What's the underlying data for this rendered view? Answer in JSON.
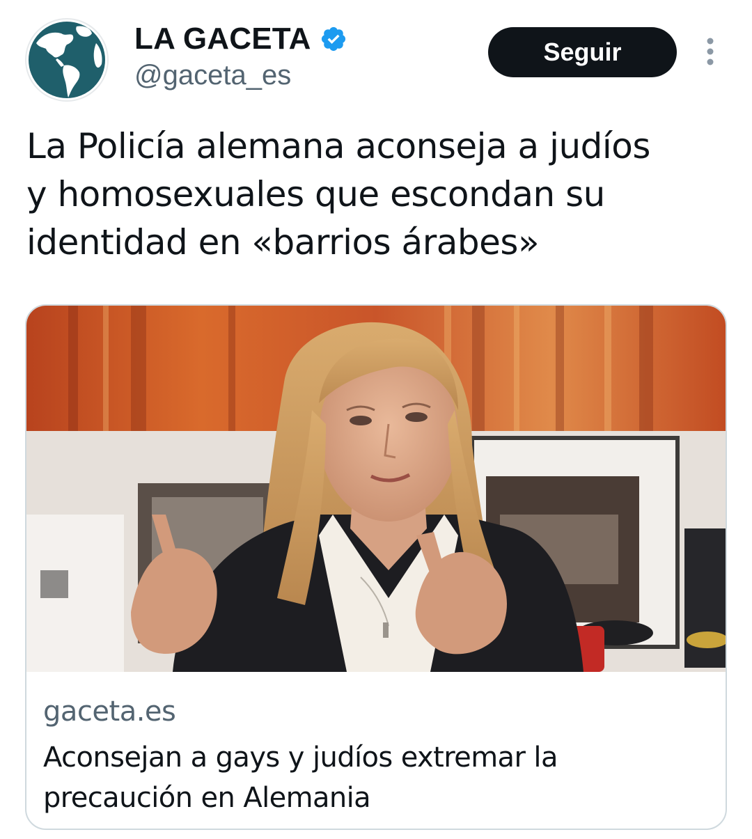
{
  "account": {
    "display_name": "LA GACETA",
    "handle": "@gaceta_es",
    "verified": true,
    "avatar_icon": "globe-icon"
  },
  "actions": {
    "follow_label": "Seguir",
    "more_icon": "more-vertical-icon"
  },
  "tweet": {
    "text_lines": [
      "La Policía alemana aconseja a judíos",
      "y homosexuales que escondan su",
      "identidad en «barrios árabes»"
    ]
  },
  "card": {
    "domain": "gaceta.es",
    "title_lines": [
      "Aconsejan a gays y judíos extremar la",
      "precaución en Alemania"
    ]
  },
  "colors": {
    "text_primary": "#0f1419",
    "text_secondary": "#536471",
    "verified_blue": "#1d9bf0",
    "button_bg": "#0f1419",
    "border": "#cfd9de",
    "avatar_globe": "#1f5f6b"
  }
}
